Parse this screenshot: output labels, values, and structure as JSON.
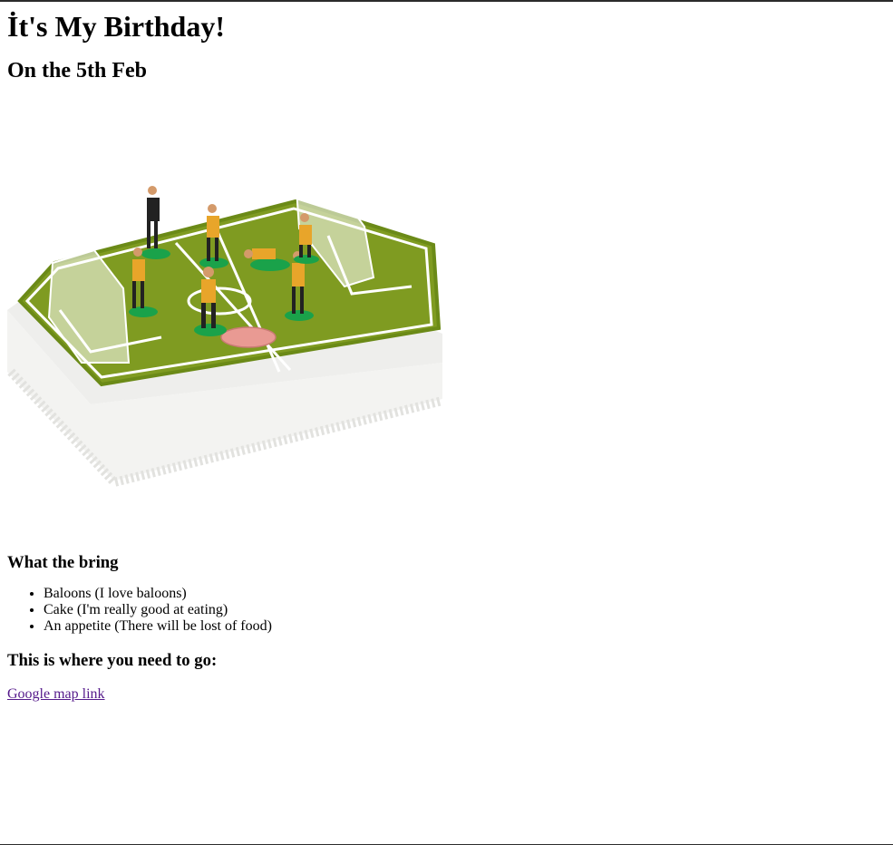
{
  "page": {
    "title": "İt's My Birthday!",
    "date_heading": "On the 5th Feb",
    "image": {
      "description_icon": "soccer-cake-image"
    },
    "bring_section": {
      "heading": "What the bring",
      "items": [
        "Baloons (I love baloons)",
        "Cake (I'm really good at eating)",
        "An appetite (There will be lost of food)"
      ]
    },
    "location_section": {
      "heading": "This is where you need to go:",
      "link_text": "Google map link"
    }
  },
  "colors": {
    "link_visited": "#551a8b",
    "pitch_green": "#7a9a1e",
    "cake_white": "#f4f4f2",
    "player_orange": "#e8a52a"
  }
}
